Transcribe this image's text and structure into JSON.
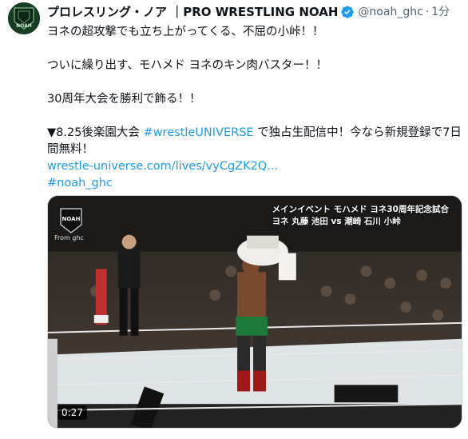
{
  "account": {
    "name": "プロレスリング・ノア ｜PRO WRESTLING NOAH",
    "handle": "@noah_ghc",
    "separator": "·",
    "time": "1分",
    "avatar_logo": "NOAH"
  },
  "tweet": {
    "line1": "ヨネの超攻撃でも立ち上がってくる、不屈の小峠！！",
    "line2": "ついに繰り出す、モハメド ヨネのキン肉バスター！！",
    "line3": "30周年大会を勝利で飾る！！",
    "line4_prefix": "▼8.25後楽園大会 ",
    "line4_hashtag": "#wrestleUNIVERSE",
    "line4_suffix": " で独占生配信中！今なら新規登録で7日間無料！",
    "url": "wrestle-universe.com/lives/vyCgZK2Q...",
    "hashtag2": "#noah_ghc"
  },
  "media": {
    "caption_line1": "メインイベント モハメド ヨネ30周年記念試合",
    "caption_line2": "ヨネ 丸藤 池田 vs 潮崎 石川 小峠",
    "watermark": "NOAH",
    "from_label": "From ghc",
    "duration": "0:27"
  },
  "colors": {
    "link": "#1d9bf0",
    "verified": "#1d9bf0",
    "muted": "#536471"
  }
}
